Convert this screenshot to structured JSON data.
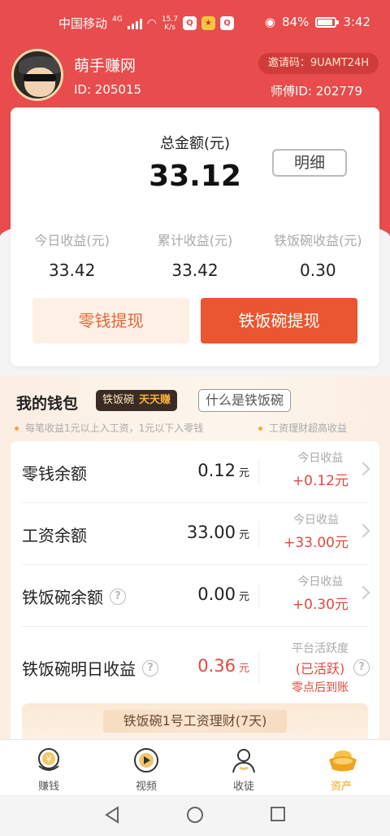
{
  "status": {
    "carrier": "中国移动",
    "net_type": "4G",
    "speed_value": "15.7",
    "speed_unit": "K/s",
    "battery": "84%",
    "time": "3:42"
  },
  "user": {
    "nickname": "萌手赚网",
    "id_text": "ID: 205015",
    "invite_code": "邀请码：9UAMT24H",
    "master_id": "师傅ID: 202779"
  },
  "summary": {
    "total_label": "总金额(元)",
    "total_value": "33.12",
    "detail_btn": "明细",
    "stats": [
      {
        "label": "今日收益(元)",
        "value": "33.42"
      },
      {
        "label": "累计收益(元)",
        "value": "33.42"
      },
      {
        "label": "铁饭碗收益(元)",
        "value": "0.30"
      }
    ],
    "btn_change": "零钱提现",
    "btn_iron": "铁饭碗提现"
  },
  "wallet": {
    "title": "我的钱包",
    "tag_left": "铁饭碗",
    "tag_right": "天天赚",
    "what_btn": "什么是铁饭碗",
    "note_left": "每笔收益1元以上入工资，1元以下入零钱",
    "note_right": "工资理财超高收益",
    "rows": [
      {
        "name": "零钱余额",
        "amount": "0.12",
        "unit": "元",
        "today_label": "今日收益",
        "today_value": "+0.12元"
      },
      {
        "name": "工资余额",
        "amount": "33.00",
        "unit": "元",
        "today_label": "今日收益",
        "today_value": "+33.00元"
      },
      {
        "name": "铁饭碗余额",
        "amount": "0.00",
        "unit": "元",
        "today_label": "今日收益",
        "today_value": "+0.30元"
      },
      {
        "name": "铁饭碗明日收益",
        "amount": "0.36",
        "unit": "元",
        "label_top": "平台活跃度",
        "label_mid": "(已活跃)",
        "label_bottom": "零点后到账"
      }
    ],
    "plan_title": "铁饭碗1号工资理财(7天)"
  },
  "nav": [
    {
      "label": "赚钱",
      "icon": "coin-icon"
    },
    {
      "label": "视频",
      "icon": "play-icon"
    },
    {
      "label": "收徒",
      "icon": "person-icon"
    },
    {
      "label": "资产",
      "icon": "gold-ingot-icon"
    }
  ],
  "colors": {
    "header_red": "#e84c4c",
    "accent_orange": "#e9562f",
    "gain_red": "#e0493f",
    "active_gold": "#f0a31c"
  }
}
